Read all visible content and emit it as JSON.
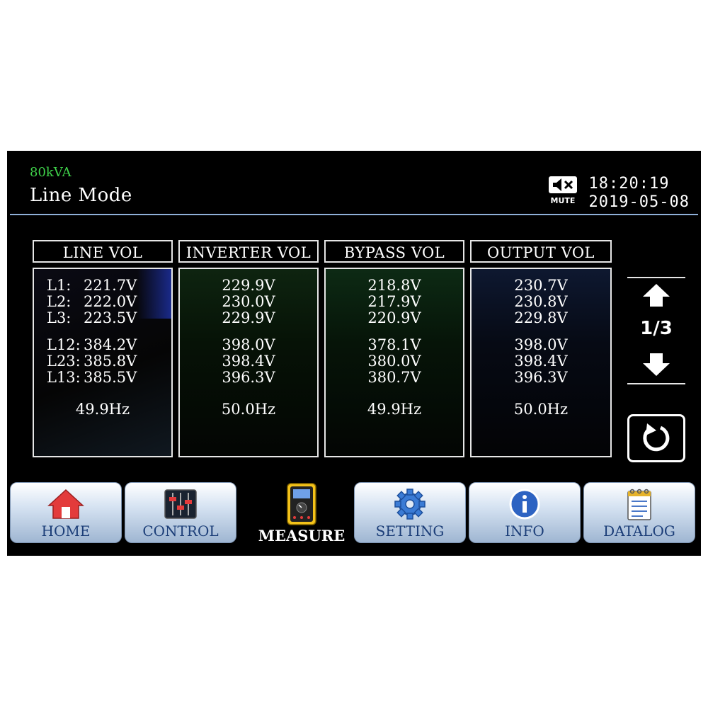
{
  "header": {
    "rating": "80kVA",
    "mode": "Line Mode",
    "mute_label": "MUTE",
    "time": "18:20:19",
    "date": "2019-05-08"
  },
  "columns": [
    {
      "title": "LINE VOL",
      "phase": [
        [
          "L1:",
          "221.7V"
        ],
        [
          "L2:",
          "222.0V"
        ],
        [
          "L3:",
          "223.5V"
        ]
      ],
      "line": [
        [
          "L12:",
          "384.2V"
        ],
        [
          "L23:",
          "385.8V"
        ],
        [
          "L13:",
          "385.5V"
        ]
      ],
      "freq": "49.9Hz"
    },
    {
      "title": "INVERTER VOL",
      "phase": [
        "229.9V",
        "230.0V",
        "229.9V"
      ],
      "line": [
        "398.0V",
        "398.4V",
        "396.3V"
      ],
      "freq": "50.0Hz"
    },
    {
      "title": "BYPASS VOL",
      "phase": [
        "218.8V",
        "217.9V",
        "220.9V"
      ],
      "line": [
        "378.1V",
        "380.0V",
        "380.7V"
      ],
      "freq": "49.9Hz"
    },
    {
      "title": "OUTPUT VOL",
      "phase": [
        "230.7V",
        "230.8V",
        "229.8V"
      ],
      "line": [
        "398.0V",
        "398.4V",
        "396.3V"
      ],
      "freq": "50.0Hz"
    }
  ],
  "pager": {
    "indicator": "1/3"
  },
  "tabs": {
    "home": "HOME",
    "control": "CONTROL",
    "measure": "MEASURE",
    "setting": "SETTING",
    "info": "INFO",
    "datalog": "DATALOG"
  },
  "colors": {
    "screen_bg": "#000000",
    "rating_green": "#3fd24a",
    "tab_text": "#1c3e78",
    "divider": "#8fb0d8"
  }
}
